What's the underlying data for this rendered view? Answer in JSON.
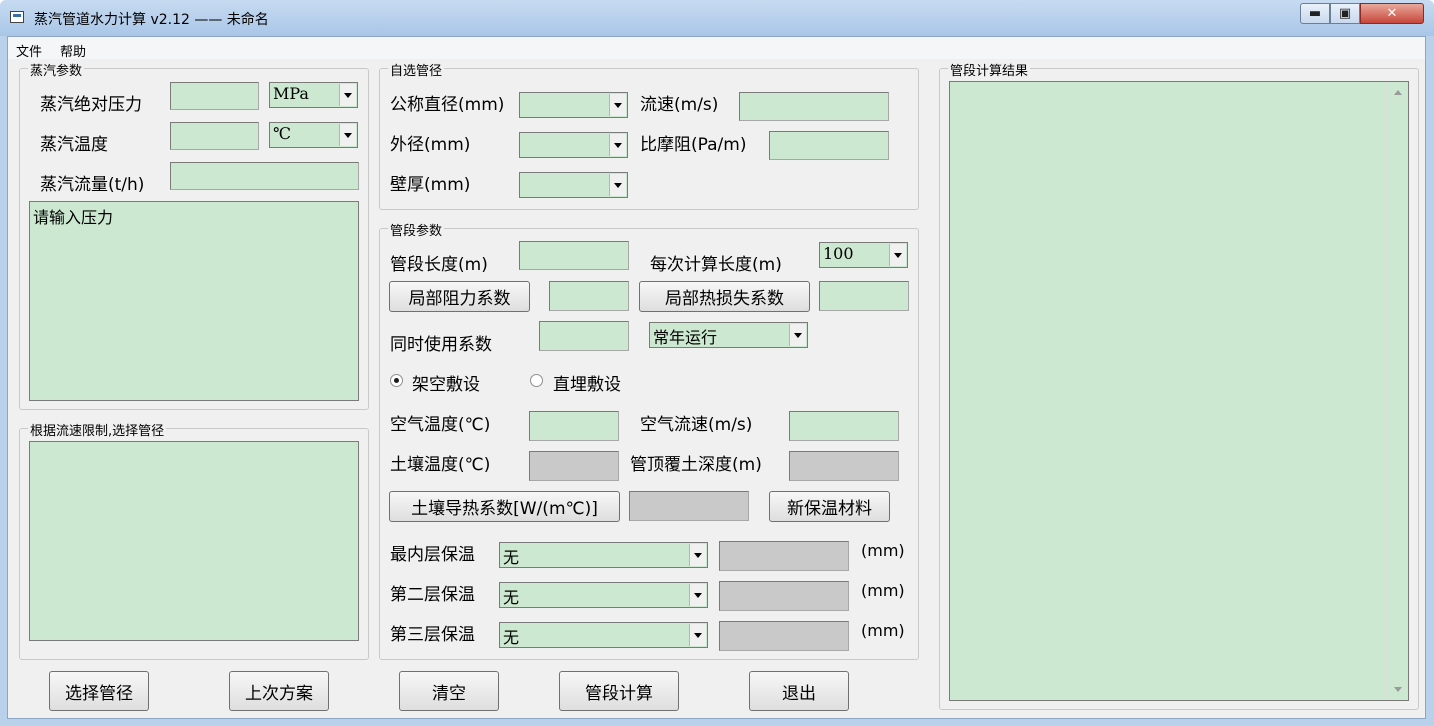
{
  "window": {
    "title": "蒸汽管道水力计算 v2.12 —— 未命名",
    "min_glyph": "▬",
    "max_glyph": "▣",
    "close_glyph": "✕"
  },
  "menu": [
    "文件",
    "帮助"
  ],
  "steam": {
    "group_label": "蒸汽参数",
    "pressure_label": "蒸汽绝对压力",
    "pressure_value": "",
    "pressure_unit": "MPa",
    "temp_label": "蒸汽温度",
    "temp_value": "",
    "temp_unit": "℃",
    "flow_label": "蒸汽流量(t/h)",
    "flow_value": "",
    "message": "请输入压力"
  },
  "velocity_group": {
    "label": "根据流速限制,选择管径"
  },
  "custom_pipe": {
    "group_label": "自选管径",
    "nominal_label": "公称直径(mm)",
    "outer_label": "外径(mm)",
    "wall_label": "壁厚(mm)",
    "velocity_label": "流速(m/s)",
    "friction_label": "比摩阻(Pa/m)"
  },
  "segment": {
    "group_label": "管段参数",
    "length_label": "管段长度(m)",
    "step_label": "每次计算长度(m)",
    "step_value": "100",
    "local_res_button": "局部阻力系数",
    "local_heat_button": "局部热损失系数",
    "simul_label": "同时使用系数",
    "operation_value": "常年运行",
    "radio_overhead": "架空敷设",
    "radio_buried": "直埋敷设",
    "air_temp_label": "空气温度(℃)",
    "air_speed_label": "空气流速(m/s)",
    "soil_temp_label": "土壤温度(℃)",
    "cover_depth_label": "管顶覆土深度(m)",
    "soil_k_button": "土壤导热系数[W/(m℃)]",
    "new_material_button": "新保温材料",
    "layers": [
      {
        "label": "最内层保温",
        "value": "无",
        "unit": "(mm)"
      },
      {
        "label": "第二层保温",
        "value": "无",
        "unit": "(mm)"
      },
      {
        "label": "第三层保温",
        "value": "无",
        "unit": "(mm)"
      }
    ]
  },
  "results": {
    "group_label": "管段计算结果"
  },
  "bottom_buttons": [
    "选择管径",
    "上次方案",
    "清空",
    "管段计算",
    "退出"
  ]
}
